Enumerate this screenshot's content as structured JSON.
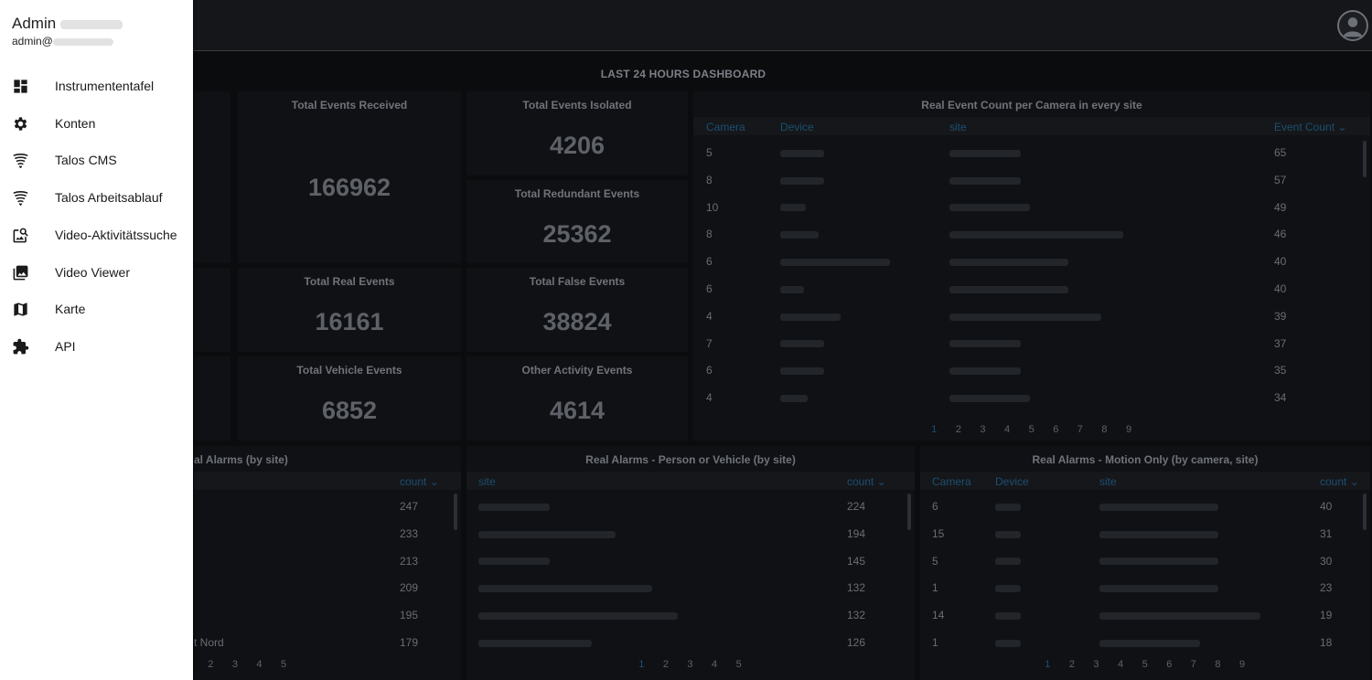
{
  "user": {
    "name": "Admin",
    "email": "admin@"
  },
  "nav": [
    {
      "label": "Instrumententafel",
      "icon": "dashboard-icon"
    },
    {
      "label": "Konten",
      "icon": "gear-icon"
    },
    {
      "label": "Talos CMS",
      "icon": "talos-icon"
    },
    {
      "label": "Talos Arbeitsablauf",
      "icon": "talos-icon"
    },
    {
      "label": "Video-Aktivitätssuche",
      "icon": "image-search-icon"
    },
    {
      "label": "Video Viewer",
      "icon": "photo-library-icon"
    },
    {
      "label": "Karte",
      "icon": "map-icon"
    },
    {
      "label": "API",
      "icon": "puzzle-icon"
    }
  ],
  "dashboard": {
    "title": "LAST 24 HOURS DASHBOARD",
    "stats": {
      "received": {
        "label": "Total Events Received",
        "value": "166962"
      },
      "isolated": {
        "label": "Total Events Isolated",
        "value": "4206"
      },
      "redundant": {
        "label": "Total Redundant Events",
        "value": "25362"
      },
      "real": {
        "label": "Total Real Events",
        "value": "16161"
      },
      "false_events": {
        "label": "Total False Events",
        "value": "38824"
      },
      "vehicle": {
        "label": "Total Vehicle Events",
        "value": "6852"
      },
      "other": {
        "label": "Other Activity Events",
        "value": "4614"
      }
    },
    "camera_table": {
      "title": "Real Event Count per Camera in every site",
      "headers": [
        "Camera",
        "Device",
        "site",
        "Event Count"
      ],
      "rows": [
        {
          "camera": "5",
          "count": "65"
        },
        {
          "camera": "8",
          "count": "57"
        },
        {
          "camera": "10",
          "count": "49"
        },
        {
          "camera": "8",
          "count": "46"
        },
        {
          "camera": "6",
          "count": "40"
        },
        {
          "camera": "6",
          "count": "40"
        },
        {
          "camera": "4",
          "count": "39"
        },
        {
          "camera": "7",
          "count": "37"
        },
        {
          "camera": "6",
          "count": "35"
        },
        {
          "camera": "4",
          "count": "34"
        }
      ],
      "pages": [
        "1",
        "2",
        "3",
        "4",
        "5",
        "6",
        "7",
        "8",
        "9"
      ]
    },
    "alarms_site": {
      "title": "al Alarms (by site)",
      "headers": [
        "count"
      ],
      "rows": [
        {
          "site": "",
          "count": "247"
        },
        {
          "site": "",
          "count": "233"
        },
        {
          "site": "",
          "count": "213"
        },
        {
          "site": "",
          "count": "209"
        },
        {
          "site": "",
          "count": "195"
        },
        {
          "site": "t Nord",
          "count": "179"
        }
      ],
      "pages": [
        "2",
        "3",
        "4",
        "5"
      ]
    },
    "alarms_person_vehicle": {
      "title": "Real Alarms - Person or Vehicle (by site)",
      "headers": [
        "site",
        "count"
      ],
      "rows": [
        {
          "count": "224"
        },
        {
          "count": "194"
        },
        {
          "count": "145"
        },
        {
          "count": "132"
        },
        {
          "count": "132"
        },
        {
          "count": "126"
        }
      ],
      "pages": [
        "1",
        "2",
        "3",
        "4",
        "5"
      ]
    },
    "alarms_motion": {
      "title": "Real Alarms - Motion Only (by camera, site)",
      "headers": [
        "Camera",
        "Device",
        "site",
        "count"
      ],
      "rows": [
        {
          "camera": "6",
          "count": "40"
        },
        {
          "camera": "15",
          "count": "31"
        },
        {
          "camera": "5",
          "count": "30"
        },
        {
          "camera": "1",
          "count": "23"
        },
        {
          "camera": "14",
          "count": "19"
        },
        {
          "camera": "1",
          "count": "18"
        }
      ],
      "pages": [
        "1",
        "2",
        "3",
        "4",
        "5",
        "6",
        "7",
        "8",
        "9"
      ]
    }
  }
}
